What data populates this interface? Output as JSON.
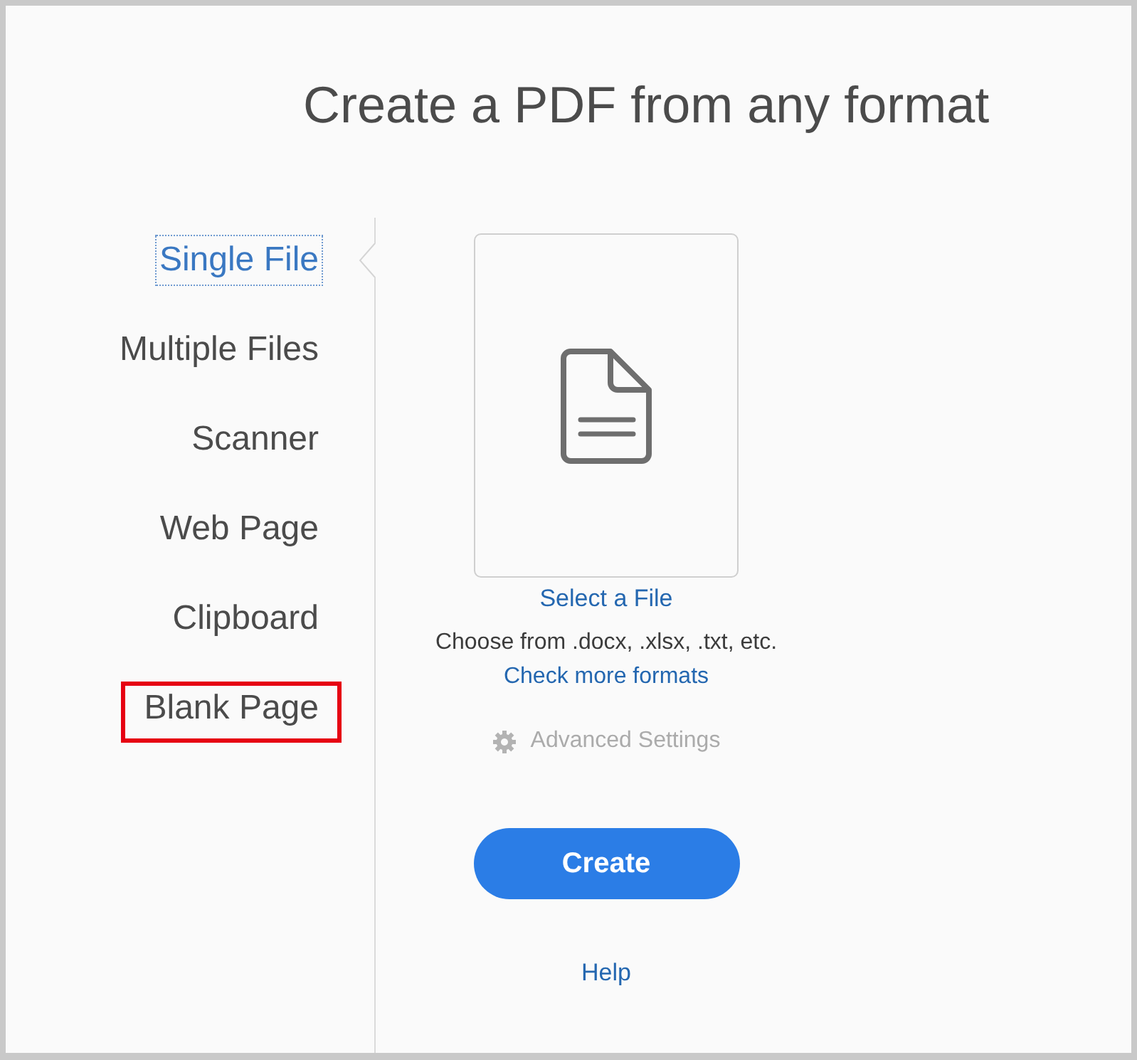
{
  "title": "Create a PDF from any format",
  "sidebar": {
    "items": [
      {
        "label": "Single File",
        "selected": true,
        "highlighted": false
      },
      {
        "label": "Multiple Files",
        "selected": false,
        "highlighted": false
      },
      {
        "label": "Scanner",
        "selected": false,
        "highlighted": false
      },
      {
        "label": "Web Page",
        "selected": false,
        "highlighted": false
      },
      {
        "label": "Clipboard",
        "selected": false,
        "highlighted": false
      },
      {
        "label": "Blank Page",
        "selected": false,
        "highlighted": true
      }
    ]
  },
  "file_picker": {
    "link": "Select a File",
    "hint": "Choose from .docx, .xlsx, .txt, etc.",
    "formats_link": "Check more formats"
  },
  "advanced_settings": {
    "label": "Advanced Settings",
    "disabled": true
  },
  "create_button": {
    "label": "Create"
  },
  "help_link": "Help"
}
